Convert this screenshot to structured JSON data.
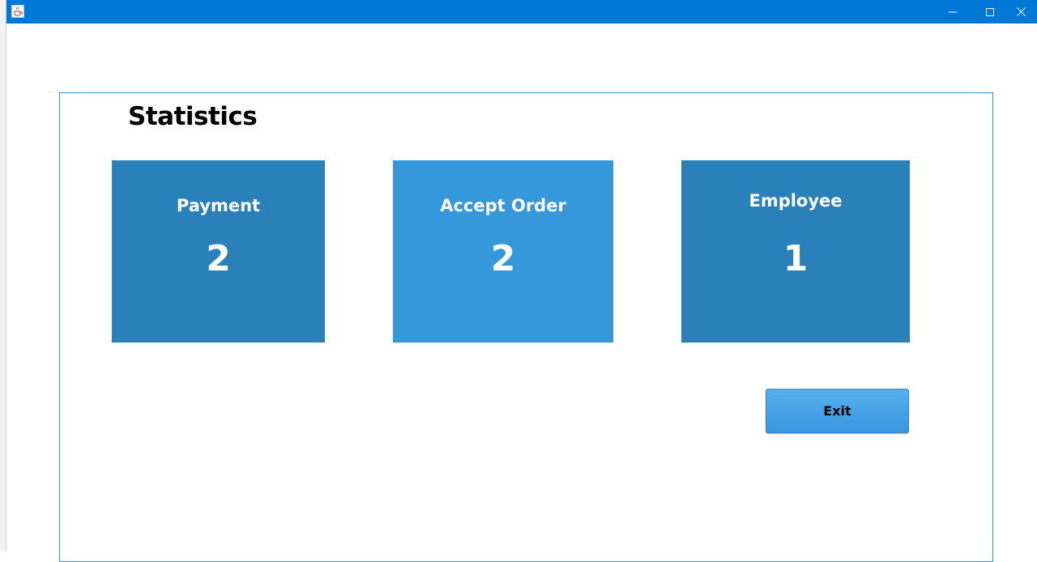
{
  "window": {
    "titlebar_color": "#0078d7",
    "icon": "java-cup-icon",
    "controls": {
      "minimize_icon": "minimize-icon",
      "maximize_icon": "maximize-icon",
      "close_icon": "close-icon"
    }
  },
  "main": {
    "title": "Statistics",
    "cards": [
      {
        "label": "Payment",
        "value": "2",
        "color": "#2a80b9"
      },
      {
        "label": "Accept Order",
        "value": "2",
        "color": "#3498db"
      },
      {
        "label": "Employee",
        "value": "1",
        "color": "#2a80b9"
      }
    ],
    "exit_label": "Exit"
  }
}
